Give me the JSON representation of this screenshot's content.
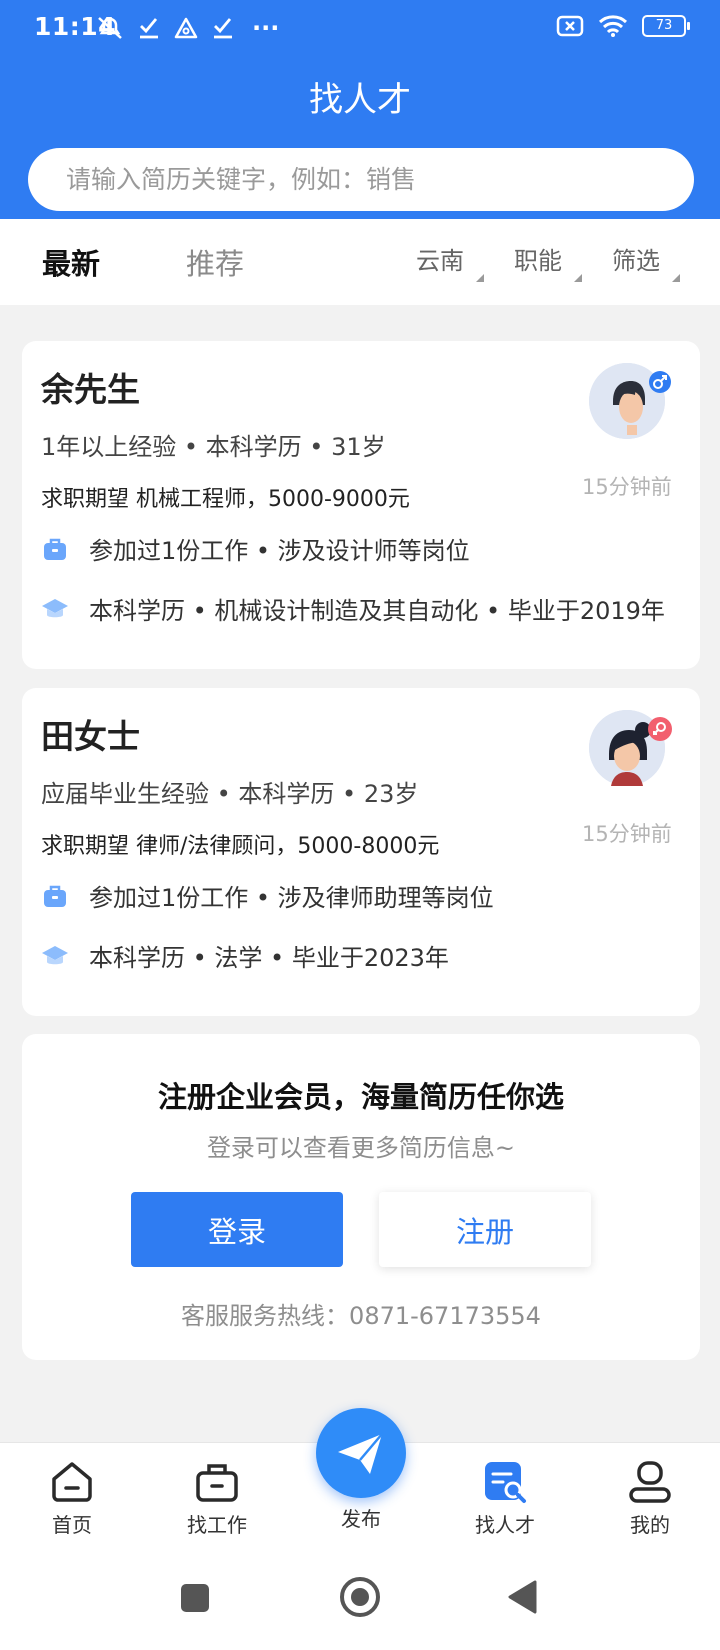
{
  "status_bar": {
    "time": "11:14",
    "battery": "73",
    "more": "···"
  },
  "header": {
    "title": "找人才"
  },
  "search": {
    "placeholder": "请输入简历关键字，例如：销售"
  },
  "tabs": [
    {
      "label": "最新",
      "active": true
    },
    {
      "label": "推荐",
      "active": false
    }
  ],
  "filters": [
    {
      "label": "云南"
    },
    {
      "label": "职能"
    },
    {
      "label": "筛选"
    }
  ],
  "candidates": [
    {
      "name": "余先生",
      "gender": "male",
      "meta": "1年以上经验 • 本科学历 • 31岁",
      "expectation": "求职期望 机械工程师，5000-9000元",
      "work": "参加过1份工作 • 涉及设计师等岗位",
      "education": "本科学历 • 机械设计制造及其自动化 • 毕业于2019年",
      "time": "15分钟前"
    },
    {
      "name": "田女士",
      "gender": "female",
      "meta": "应届毕业生经验 • 本科学历 • 23岁",
      "expectation": "求职期望 律师/法律顾问，5000-8000元",
      "work": "参加过1份工作 • 涉及律师助理等岗位",
      "education": "本科学历 • 法学 • 毕业于2023年",
      "time": "15分钟前"
    }
  ],
  "promo": {
    "title": "注册企业会员，海量简历任你选",
    "subtitle": "登录可以查看更多简历信息~",
    "login": "登录",
    "register": "注册",
    "hotline": "客服服务热线：0871-67173554"
  },
  "bottom_nav": [
    {
      "label": "首页",
      "icon": "home-icon"
    },
    {
      "label": "找工作",
      "icon": "briefcase-icon"
    },
    {
      "label": "发布",
      "icon": "paper-plane-icon"
    },
    {
      "label": "找人才",
      "icon": "resume-search-icon",
      "active": true
    },
    {
      "label": "我的",
      "icon": "user-icon"
    }
  ],
  "colors": {
    "primary": "#2f7cf2",
    "text": "#222222",
    "muted": "#8e8e8e",
    "female_badge": "#f25f6e"
  }
}
